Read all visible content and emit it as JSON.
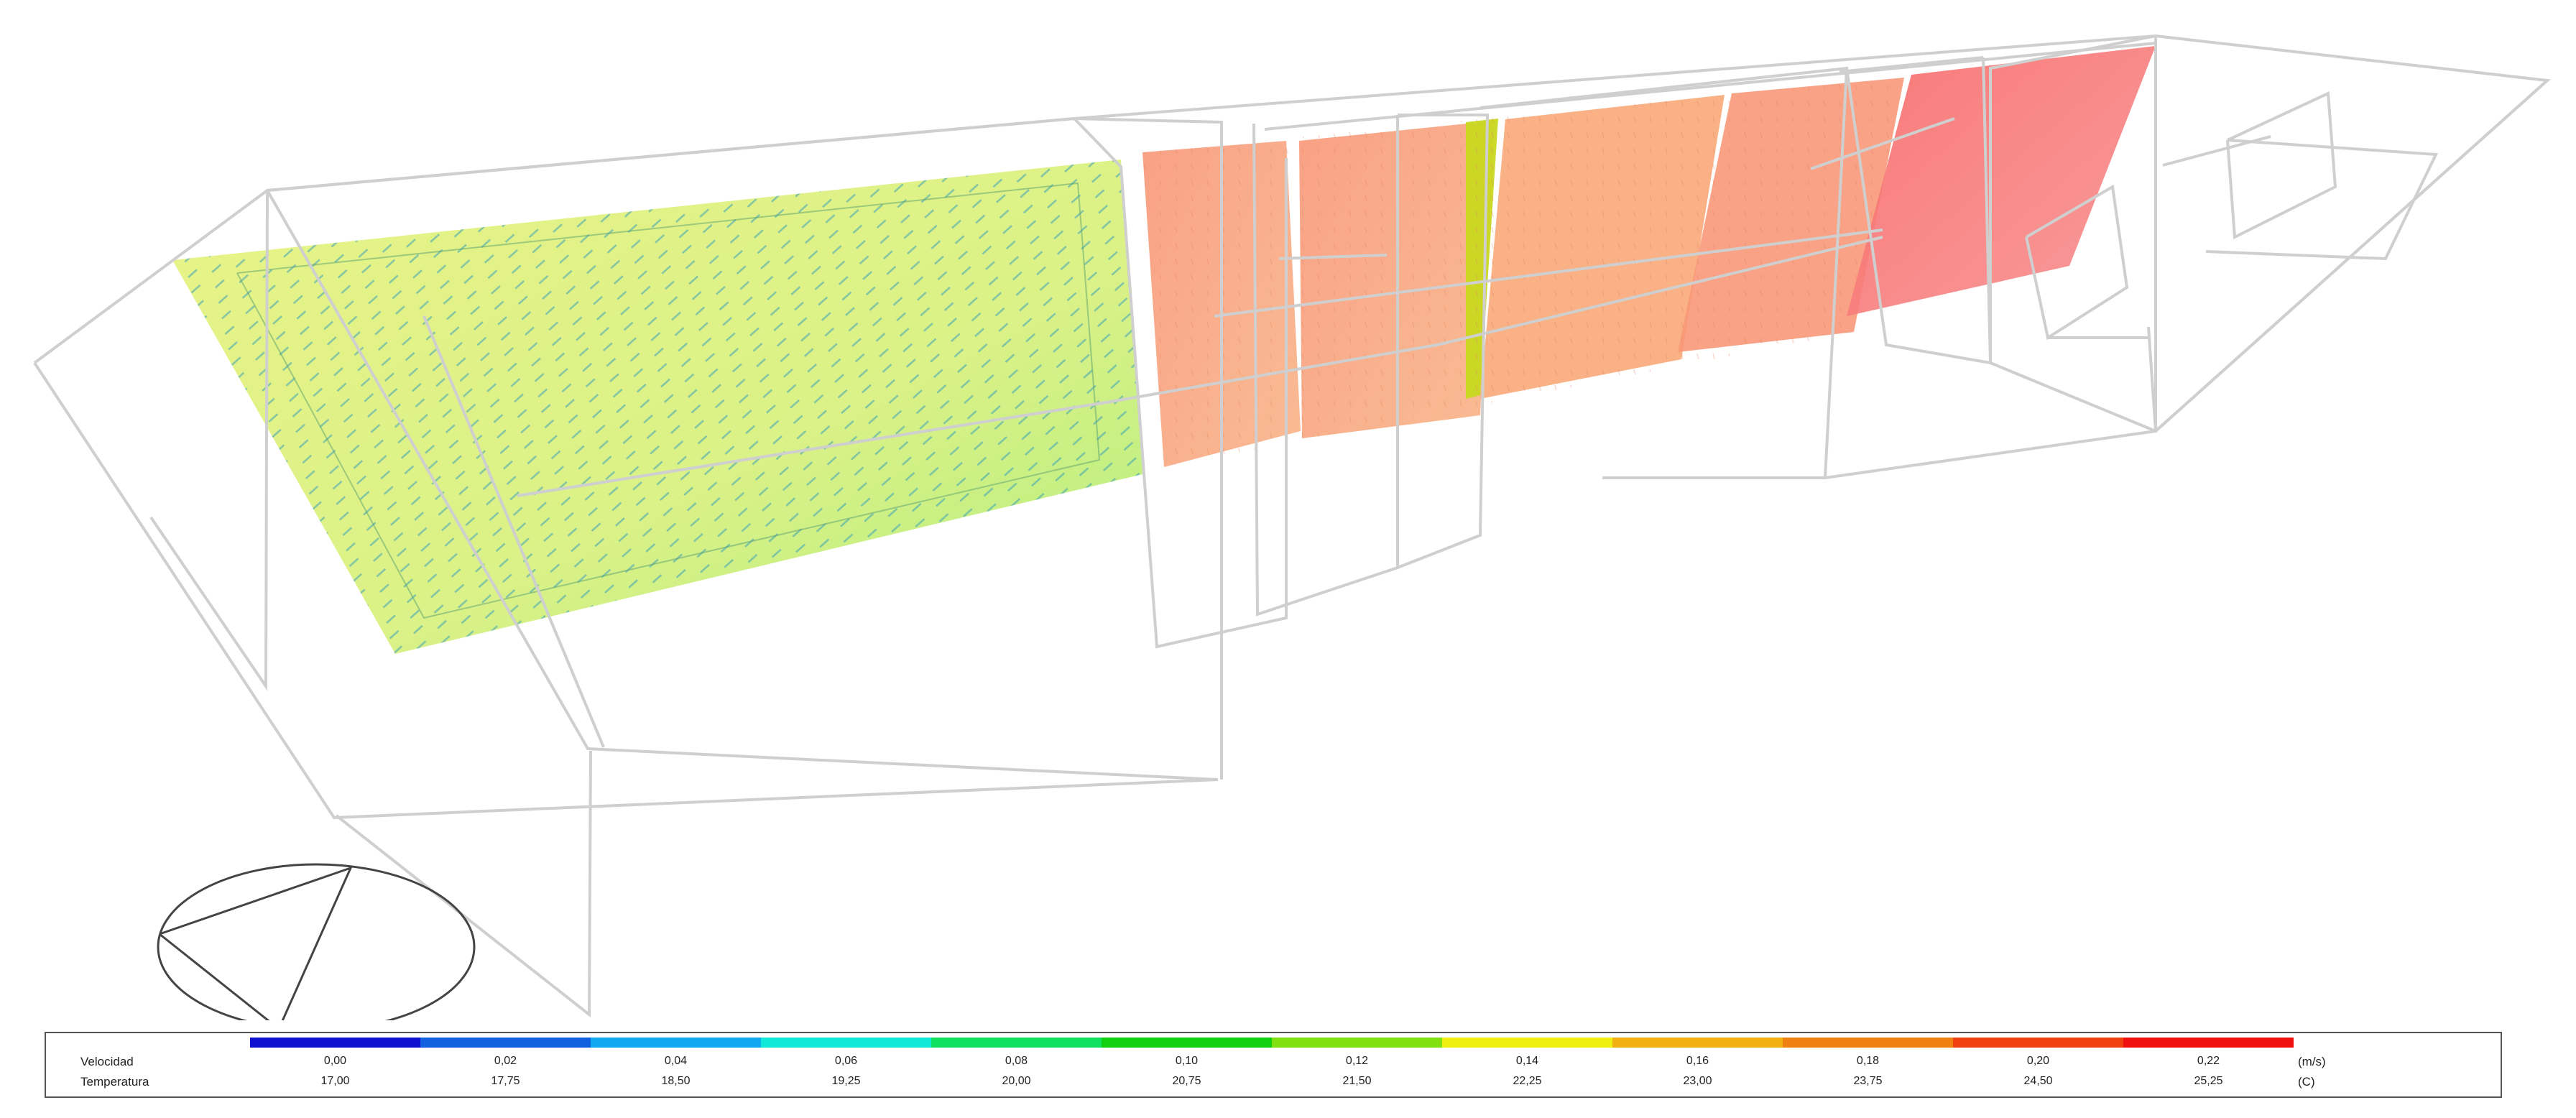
{
  "legend": {
    "velocity_label": "Velocidad",
    "temperature_label": "Temperatura",
    "velocity_unit": "(m/s)",
    "temperature_unit": "(C)",
    "velocity_ticks": [
      "0,00",
      "0,02",
      "0,04",
      "0,06",
      "0,08",
      "0,10",
      "0,12",
      "0,14",
      "0,16",
      "0,18",
      "0,20",
      "0,22"
    ],
    "temperature_ticks": [
      "17,00",
      "17,75",
      "18,50",
      "19,25",
      "20,00",
      "20,75",
      "21,50",
      "22,25",
      "23,00",
      "23,75",
      "24,50",
      "25,25"
    ],
    "colors": [
      "#1010d0",
      "#1060e0",
      "#10a8f0",
      "#10e8d8",
      "#10e060",
      "#10d010",
      "#80e010",
      "#f0f010",
      "#f0b010",
      "#f08010",
      "#f04010",
      "#f01010"
    ]
  },
  "colors": {
    "wireframe": "#cfcfcf",
    "cold_plane": "#d8f078",
    "warm_plane": "#f8a070",
    "hot_plane": "#f87070",
    "vectors": "#40a0b0"
  }
}
